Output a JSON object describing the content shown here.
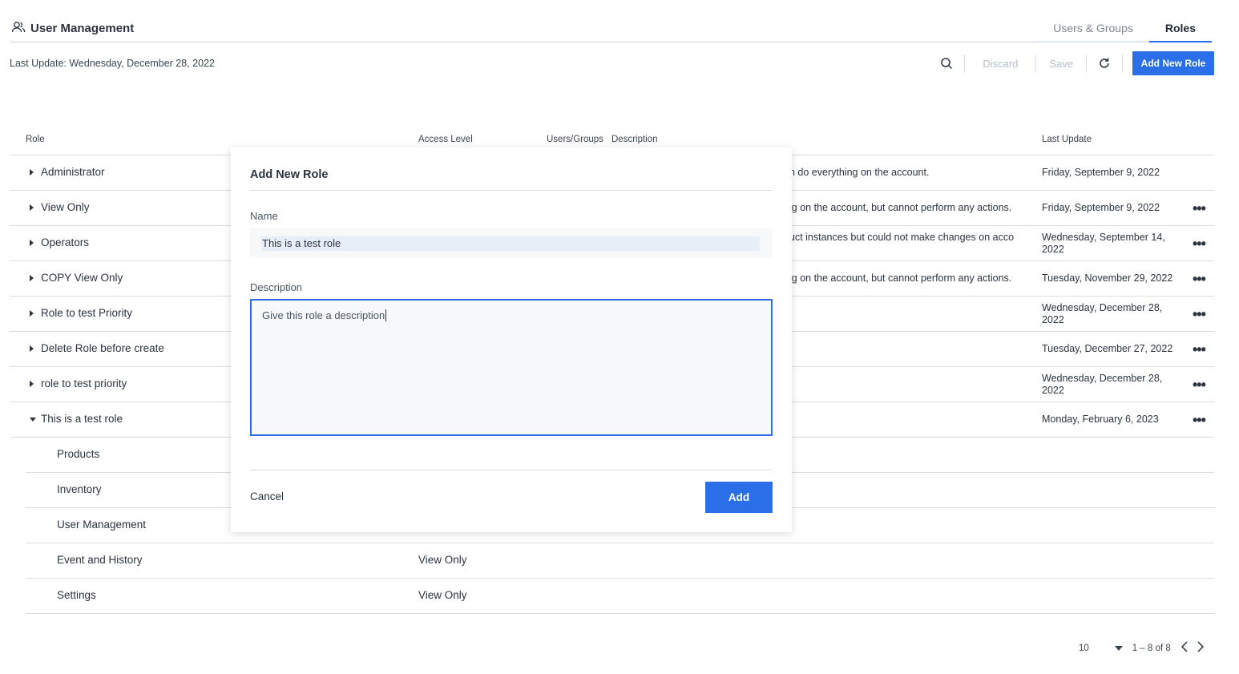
{
  "header": {
    "icon": "users-icon",
    "title": "User Management",
    "tabs": [
      {
        "label": "Users & Groups",
        "active": false
      },
      {
        "label": "Roles",
        "active": true
      }
    ]
  },
  "toolbar": {
    "last_update": "Last Update: Wednesday, December 28, 2022",
    "search_icon": "search-icon",
    "discard_label": "Discard",
    "save_label": "Save",
    "refresh_icon": "refresh-icon",
    "add_role_label": "Add New Role"
  },
  "table": {
    "columns": {
      "role": "Role",
      "access": "Access Level",
      "users": "Users/Groups",
      "description": "Description",
      "last_update": "Last Update"
    },
    "rows": [
      {
        "name": "Administrator",
        "desc": "n do everything on the account.",
        "date": "Friday, September 9, 2022",
        "more": ""
      },
      {
        "name": "View Only",
        "desc": "ig on the account, but cannot perform any actions.",
        "date": "Friday, September 9, 2022",
        "more": "•••"
      },
      {
        "name": "Operators",
        "desc": "uct instances but could not make changes on acco",
        "date": "Wednesday, September 14, 2022",
        "more": "•••"
      },
      {
        "name": "COPY View Only",
        "desc": "ig on the account, but cannot perform any actions.",
        "date": "Tuesday, November 29, 2022",
        "more": "•••"
      },
      {
        "name": "Role to test Priority",
        "desc": "",
        "date": "Wednesday, December 28, 2022",
        "more": "•••"
      },
      {
        "name": "Delete Role before create",
        "desc": "",
        "date": "Tuesday, December 27, 2022",
        "more": "•••"
      },
      {
        "name": "role to test priority",
        "desc": "",
        "date": "Wednesday, December 28, 2022",
        "more": "•••"
      },
      {
        "name": "This is a test role",
        "desc": "",
        "date": "Monday, February 6, 2023",
        "more": "•••"
      }
    ],
    "children": [
      {
        "name": "Products",
        "access": ""
      },
      {
        "name": "Inventory",
        "access": ""
      },
      {
        "name": "User Management",
        "access": ""
      },
      {
        "name": "Event and History",
        "access": "View Only"
      },
      {
        "name": "Settings",
        "access": "View Only"
      }
    ]
  },
  "pagination": {
    "page_size": "10",
    "range": "1 – 8 of 8"
  },
  "modal": {
    "title": "Add New Role",
    "name_label": "Name",
    "name_value": "This is a test role",
    "description_label": "Description",
    "description_value": "Give this role a description",
    "cancel_label": "Cancel",
    "add_label": "Add"
  },
  "colors": {
    "accent": "#2a6ee8",
    "text": "#2b3440",
    "muted": "#b6bec8"
  }
}
